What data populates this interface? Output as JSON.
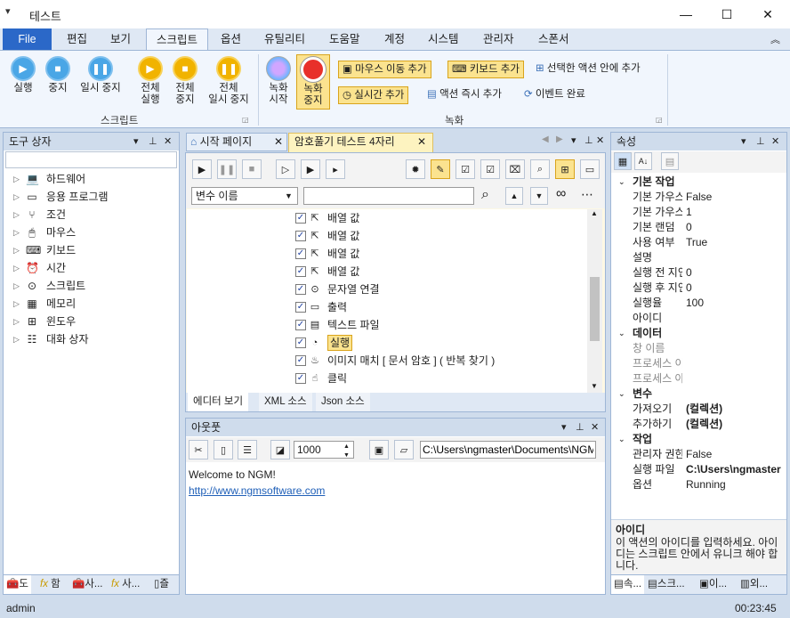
{
  "window": {
    "title": "테스트"
  },
  "ribbon_tabs": [
    "File",
    "편집",
    "보기",
    "스크립트",
    "옵션",
    "유틸리티",
    "도움말",
    "계정",
    "시스템",
    "관리자",
    "스폰서"
  ],
  "script_group": {
    "label": "스크립트",
    "run": "실행",
    "stop": "중지",
    "pause": "일시 중지",
    "run_all_l1": "전체",
    "run_all_l2": "실행",
    "stop_all_l1": "전체",
    "stop_all_l2": "중지",
    "pause_all_l1": "전체",
    "pause_all_l2": "일시 중지"
  },
  "record_group": {
    "label": "녹화",
    "record_start_l1": "녹화",
    "record_start_l2": "시작",
    "record_stop_l1": "녹화",
    "record_stop_l2": "중지",
    "add_mouse_move": "마우스 이동 추가",
    "add_keyboard": "키보드 추가",
    "add_in_selected": "선택한 액션 안에 추가",
    "add_realtime": "실시간 추가",
    "run_action_now": "액션 즉시 추가",
    "event_complete": "이벤트 완료"
  },
  "toolbox": {
    "title": "도구 상자",
    "items": [
      "하드웨어",
      "응용 프로그램",
      "조건",
      "마우스",
      "키보드",
      "시간",
      "스크립트",
      "메모리",
      "윈도우",
      "대화 상자"
    ],
    "bottom_tabs": [
      "도",
      "함",
      "사...",
      "사...",
      "즐"
    ]
  },
  "doc_tabs": [
    "시작 페이지",
    "암호풀기 테스트 4자리"
  ],
  "editor": {
    "variable_select": "변수 이름",
    "rows": [
      {
        "icon": "mouse-pointer",
        "label": "배열 값"
      },
      {
        "icon": "mouse-pointer",
        "label": "배열 값"
      },
      {
        "icon": "mouse-pointer",
        "label": "배열 값"
      },
      {
        "icon": "mouse-pointer",
        "label": "배열 값"
      },
      {
        "icon": "dots-circle",
        "label": "문자열 연결"
      },
      {
        "icon": "console",
        "label": "출력"
      },
      {
        "icon": "text-file",
        "label": "텍스트 파일"
      },
      {
        "icon": "run-timer",
        "label": "실행"
      },
      {
        "icon": "image-match",
        "label": "이미지 매치 [ 문서 암호 ] ( 반복 찾기 )"
      },
      {
        "icon": "click-hand",
        "label": "클릭"
      }
    ],
    "bottom_tabs": [
      "에디터 보기",
      "XML 소스",
      "Json 소스"
    ]
  },
  "output": {
    "title": "아웃풋",
    "interval": "1000",
    "path": "C:\\Users\\ngmaster\\Documents\\NGM",
    "welcome": "Welcome to NGM!",
    "link": "http://www.ngmsoftware.com"
  },
  "properties": {
    "title": "속성",
    "categories": [
      {
        "name": "기본 작업",
        "rows": [
          {
            "name": "기본 가우스",
            "value": "False"
          },
          {
            "name": "기본 가우스",
            "value": "1"
          },
          {
            "name": "기본 랜덤",
            "value": "0"
          },
          {
            "name": "사용 여부",
            "value": "True"
          },
          {
            "name": "설명",
            "value": ""
          },
          {
            "name": "실행 전 지연",
            "value": "0"
          },
          {
            "name": "실행 후 지연",
            "value": "0"
          },
          {
            "name": "실행율",
            "value": "100"
          },
          {
            "name": "아이디",
            "value": ""
          }
        ]
      },
      {
        "name": "데이터",
        "rows": [
          {
            "name": "창 이름",
            "value": ""
          },
          {
            "name": "프로세스 이름",
            "value": ""
          },
          {
            "name": "프로세스 아이디",
            "value": ""
          }
        ]
      },
      {
        "name": "변수",
        "rows": [
          {
            "name": "가져오기",
            "value": "(컬렉션)"
          },
          {
            "name": "추가하기",
            "value": "(컬렉션)"
          }
        ]
      },
      {
        "name": "작업",
        "rows": [
          {
            "name": "관리자 권한",
            "value": "False"
          },
          {
            "name": "실행 파일",
            "value": "C:\\Users\\ngmaster"
          },
          {
            "name": "옵션",
            "value": "Running"
          }
        ]
      }
    ],
    "desc_title": "아이디",
    "desc_text": "이 액션의 아이디를 입력하세요. 아이디는 스크립트 안에서 유니크 해야 합니다.",
    "bottom_tabs": [
      "속...",
      "스크...",
      "이...",
      "외..."
    ]
  },
  "status": {
    "user": "admin",
    "time": "00:23:45"
  }
}
